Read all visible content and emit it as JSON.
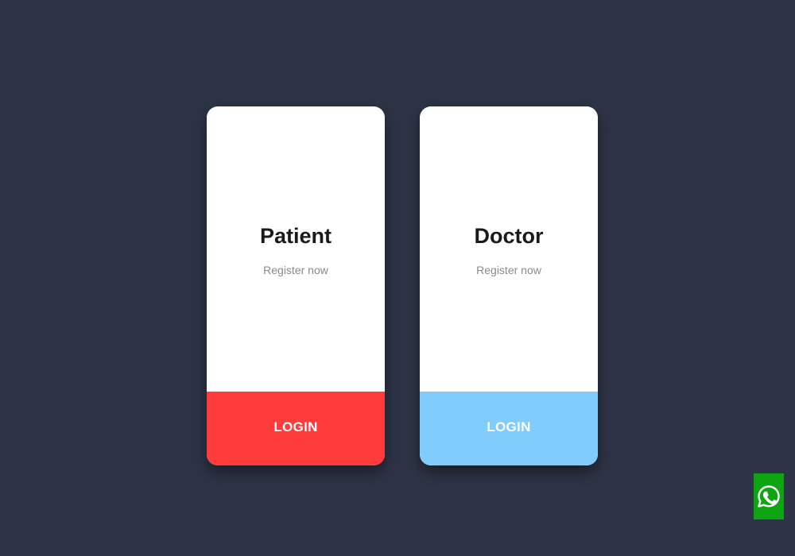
{
  "cards": [
    {
      "title": "Patient",
      "subtitle": "Register now",
      "button_label": "LOGIN",
      "button_color": "#ff3b3b"
    },
    {
      "title": "Doctor",
      "subtitle": "Register now",
      "button_label": "LOGIN",
      "button_color": "#80cdfd"
    }
  ],
  "background_color": "#2d3446",
  "floating_button": {
    "icon": "whatsapp-icon",
    "color": "#0ea513"
  }
}
